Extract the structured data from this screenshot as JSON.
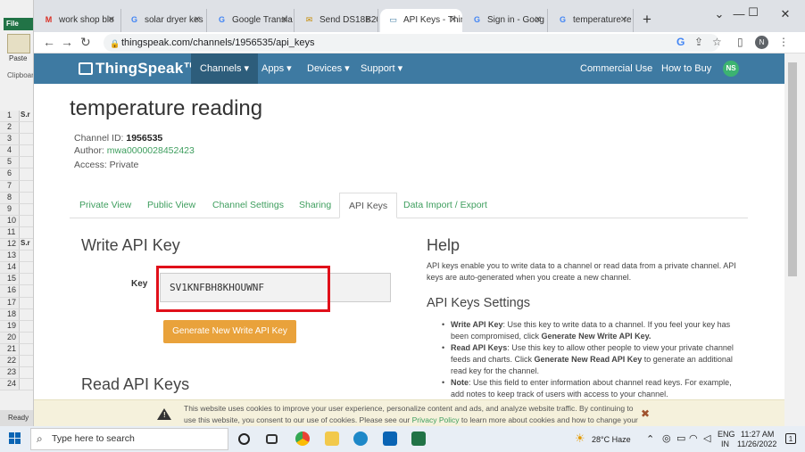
{
  "excel": {
    "file": "File",
    "paste": "Paste",
    "clipboard": "Clipboard",
    "rows": [
      {
        "n": "1",
        "c": "S.r"
      },
      {
        "n": "2",
        "c": ""
      },
      {
        "n": "3",
        "c": ""
      },
      {
        "n": "4",
        "c": ""
      },
      {
        "n": "5",
        "c": ""
      },
      {
        "n": "6",
        "c": ""
      },
      {
        "n": "7",
        "c": ""
      },
      {
        "n": "8",
        "c": ""
      },
      {
        "n": "9",
        "c": ""
      },
      {
        "n": "10",
        "c": ""
      },
      {
        "n": "11",
        "c": ""
      },
      {
        "n": "12",
        "c": "S.r"
      },
      {
        "n": "13",
        "c": ""
      },
      {
        "n": "14",
        "c": ""
      },
      {
        "n": "15",
        "c": ""
      },
      {
        "n": "16",
        "c": ""
      },
      {
        "n": "17",
        "c": ""
      },
      {
        "n": "18",
        "c": ""
      },
      {
        "n": "19",
        "c": ""
      },
      {
        "n": "20",
        "c": ""
      },
      {
        "n": "21",
        "c": ""
      },
      {
        "n": "22",
        "c": ""
      },
      {
        "n": "23",
        "c": ""
      },
      {
        "n": "24",
        "c": ""
      }
    ],
    "status": "Ready"
  },
  "browser": {
    "tabs": [
      {
        "icon": "M",
        "label": "work shop blo",
        "color": "#d93025"
      },
      {
        "icon": "G",
        "label": "solar dryer kes",
        "color": "#4285f4"
      },
      {
        "icon": "G",
        "label": "Google Transla",
        "color": "#4285f4"
      },
      {
        "icon": "✉",
        "label": "Send DS18B20",
        "color": "#c58a00"
      },
      {
        "icon": "▭",
        "label": "API Keys - Thin",
        "color": "#3e7aa2"
      },
      {
        "icon": "G",
        "label": "Sign in - Goog",
        "color": "#4285f4"
      },
      {
        "icon": "G",
        "label": "temperature re",
        "color": "#4285f4"
      }
    ],
    "url": "thingspeak.com/channels/1956535/api_keys",
    "profile": "N"
  },
  "site": {
    "logo": "ThingSpeak™",
    "nav": {
      "channels": "Channels ▾",
      "apps": "Apps ▾",
      "devices": "Devices ▾",
      "support": "Support ▾",
      "commercial": "Commercial Use",
      "buy": "How to Buy",
      "user": "NS"
    },
    "title": "temperature reading",
    "channel_id_label": "Channel ID: ",
    "channel_id": "1956535",
    "author_label": "Author: ",
    "author": "mwa0000028452423",
    "access": "Access: Private",
    "tabs": [
      "Private View",
      "Public View",
      "Channel Settings",
      "Sharing",
      "API Keys",
      "Data Import / Export"
    ],
    "write_title": "Write API Key",
    "key_label": "Key",
    "key_value": "SV1KNFBH8KHOUWNF",
    "gen_button": "Generate New Write API Key",
    "read_title": "Read API Keys",
    "help_title": "Help",
    "help_text": "API keys enable you to write data to a channel or read data from a private channel. API keys are auto-generated when you create a new channel.",
    "settings_title": "API Keys Settings",
    "items": [
      {
        "b": "Write API Key",
        "t": ": Use this key to write data to a channel. If you feel your key has been compromised, click ",
        "b2": "Generate New Write API Key.",
        "t2": ""
      },
      {
        "b": "Read API Keys",
        "t": ": Use this key to allow other people to view your private channel feeds and charts. Click ",
        "b2": "Generate New Read API Key",
        "t2": " to generate an additional read key for the channel."
      },
      {
        "b": "Note",
        "t": ": Use this field to enter information about channel read keys. For example, add notes to keep track of users with access to your channel.",
        "b2": "",
        "t2": ""
      }
    ],
    "cookie": {
      "text1": "This website uses cookies to improve your user experience, personalize content and ads, and analyze website traffic. By continuing to use this website, you consent to our use of cookies. Please see our ",
      "link": "Privacy Policy",
      "text2": " to learn more about cookies and how to change your settings.",
      "close": "✖"
    }
  },
  "taskbar": {
    "search": "Type here to search",
    "weather": "28°C  Haze",
    "lang1": "ENG",
    "lang2": "IN",
    "time": "11:27 AM",
    "date": "11/26/2022",
    "notif": "1"
  }
}
